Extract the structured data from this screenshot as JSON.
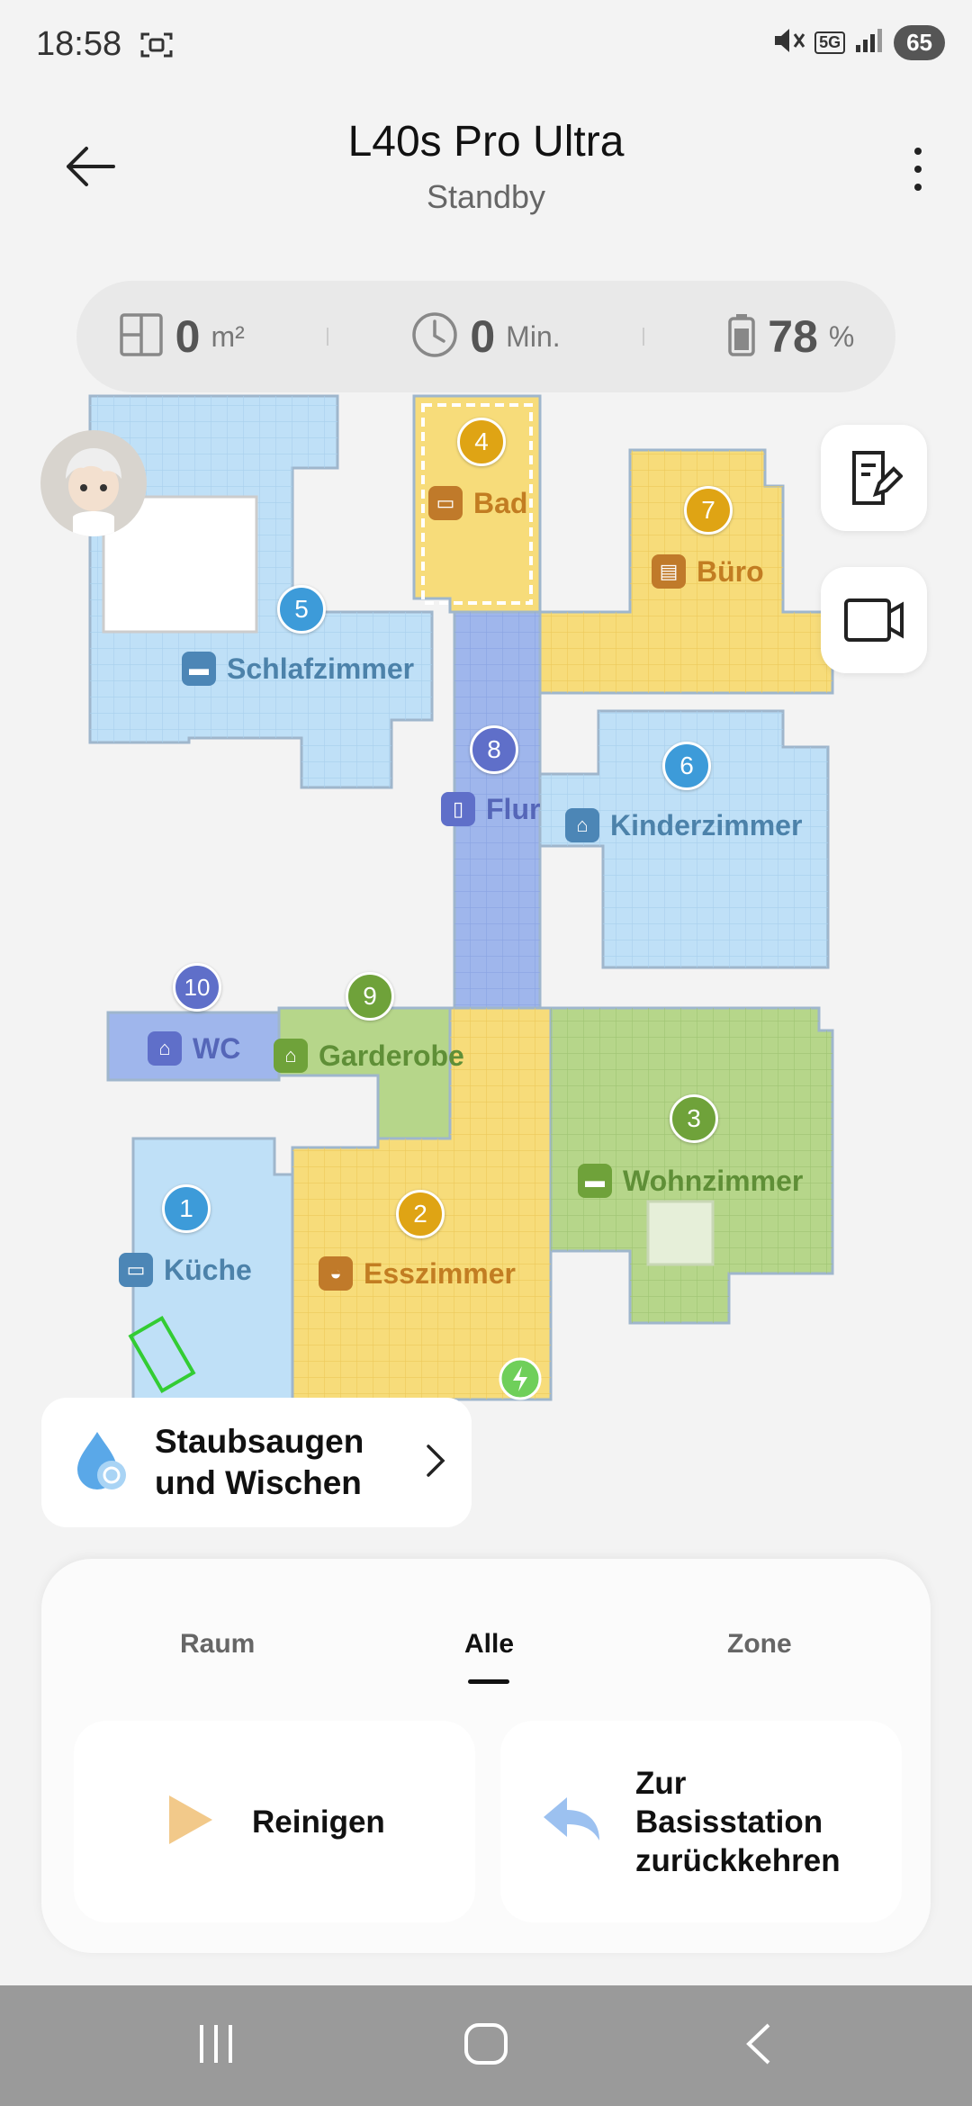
{
  "status_bar": {
    "time": "18:58",
    "network": "5G",
    "battery": "65"
  },
  "header": {
    "title": "L40s Pro Ultra",
    "subtitle": "Standby"
  },
  "stats": {
    "area_value": "0",
    "area_unit": "m²",
    "time_value": "0",
    "time_unit": "Min.",
    "battery_value": "78",
    "battery_unit": "%"
  },
  "rooms": [
    {
      "number": "1",
      "name": "Küche"
    },
    {
      "number": "2",
      "name": "Esszimmer"
    },
    {
      "number": "3",
      "name": "Wohnzimmer"
    },
    {
      "number": "4",
      "name": "Bad"
    },
    {
      "number": "5",
      "name": "Schlafzimmer"
    },
    {
      "number": "6",
      "name": "Kinderzimmer"
    },
    {
      "number": "7",
      "name": "Büro"
    },
    {
      "number": "8",
      "name": "Flur"
    },
    {
      "number": "9",
      "name": "Garderobe"
    },
    {
      "number": "10",
      "name": "WC"
    }
  ],
  "mode": {
    "label": "Staubsaugen und Wischen"
  },
  "tabs": [
    {
      "label": "Raum"
    },
    {
      "label": "Alle"
    },
    {
      "label": "Zone"
    }
  ],
  "actions": {
    "clean": "Reinigen",
    "return_home": "Zur Basisstation zurückkehren"
  },
  "colors": {
    "blue_room": "#bfe0f7",
    "purple_room": "#9fb6ec",
    "yellow_room": "#f7dc7a",
    "green_room": "#b6d68a",
    "pin_blue": "#3d9bd9",
    "pin_yellow": "#dfa414",
    "pin_green": "#6fa23a",
    "pin_purple": "#5f6fc9"
  }
}
